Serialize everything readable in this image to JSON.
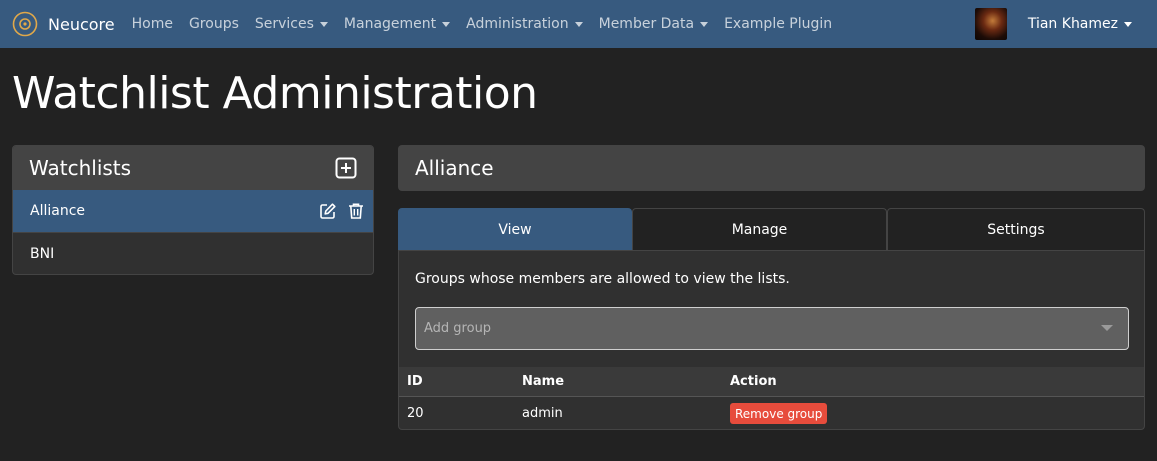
{
  "navbar": {
    "brand": "Neucore",
    "links": [
      {
        "label": "Home",
        "dropdown": false
      },
      {
        "label": "Groups",
        "dropdown": false
      },
      {
        "label": "Services",
        "dropdown": true
      },
      {
        "label": "Management",
        "dropdown": true
      },
      {
        "label": "Administration",
        "dropdown": true
      },
      {
        "label": "Member Data",
        "dropdown": true
      },
      {
        "label": "Example Plugin",
        "dropdown": false
      }
    ],
    "user": "Tian Khamez"
  },
  "page": {
    "title": "Watchlist Administration"
  },
  "watchlists": {
    "title": "Watchlists",
    "items": [
      {
        "label": "Alliance",
        "active": true
      },
      {
        "label": "BNI",
        "active": false
      }
    ]
  },
  "detail": {
    "title": "Alliance",
    "tabs": [
      {
        "label": "View",
        "active": true
      },
      {
        "label": "Manage",
        "active": false
      },
      {
        "label": "Settings",
        "active": false
      }
    ],
    "description": "Groups whose members are allowed to view the lists.",
    "select_placeholder": "Add group",
    "table": {
      "headers": [
        "ID",
        "Name",
        "Action"
      ],
      "rows": [
        {
          "id": "20",
          "name": "admin",
          "action": "Remove group"
        }
      ]
    }
  },
  "colors": {
    "navbar": "#375a7f",
    "background": "#222222",
    "danger": "#e74c3c"
  }
}
